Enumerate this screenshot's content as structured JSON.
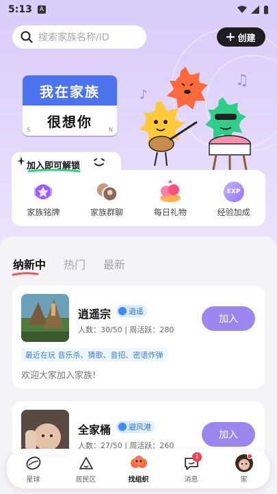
{
  "status_bar": {
    "time": "5:13",
    "a_badge": "A"
  },
  "search": {
    "placeholder": "搜索家族名称/ID"
  },
  "create_button": {
    "label": "创建"
  },
  "hero": {
    "sign_top": "我在家族",
    "sign_bottom": "想你",
    "sign_bottom_prefix": "很",
    "compass_s": "S",
    "compass_n": "N"
  },
  "unlock": {
    "title": "加入即可解锁",
    "items": [
      {
        "label": "家族铭牌",
        "icon": "badge-medal-icon"
      },
      {
        "label": "家族群聊",
        "icon": "group-chat-avatars-icon"
      },
      {
        "label": "每日礼物",
        "icon": "gift-icon"
      },
      {
        "label": "经验加成",
        "icon": "exp-icon",
        "icon_text": "EXP"
      }
    ]
  },
  "tabs": [
    {
      "label": "纳新中",
      "active": true
    },
    {
      "label": "热门",
      "active": false
    },
    {
      "label": "最新",
      "active": false
    }
  ],
  "families": [
    {
      "name": "逍遥宗",
      "tag": "逍遥",
      "members": "人数：30/50",
      "weekly": "周活跃：280",
      "recent": "最近在玩 音乐杀、猜歌、音招、密语炸弹",
      "welcome": "欢迎大家加入家族!",
      "join_label": "加入"
    },
    {
      "name": "全家桶",
      "tag": "避风港",
      "members": "人数：27/50",
      "weekly": "周活跃：260",
      "join_label": "加入"
    }
  ],
  "bottom_nav": [
    {
      "label": "星球",
      "icon": "planet-icon",
      "active": false
    },
    {
      "label": "居民区",
      "icon": "house-icon",
      "active": false
    },
    {
      "label": "找组织",
      "icon": "organization-icon",
      "active": true
    },
    {
      "label": "消息",
      "icon": "message-icon",
      "active": false,
      "badge": "1"
    },
    {
      "label": "家",
      "icon": "profile-avatar-icon",
      "active": false
    }
  ],
  "colors": {
    "accent": "#9b87f0",
    "sign_blue": "#4b73ee",
    "tag_blue": "#2b73d9",
    "dark_button": "#1e1e22"
  }
}
